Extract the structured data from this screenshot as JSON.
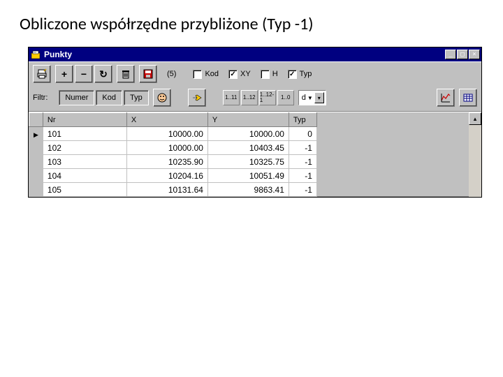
{
  "heading": "Obliczone współrzędne przybliżone (Typ -1)",
  "window": {
    "title": "Punkty",
    "count_text": "(5)",
    "checkboxes": {
      "kod": {
        "label": "Kod",
        "checked": false
      },
      "xy": {
        "label": "XY",
        "checked": true
      },
      "h": {
        "label": "H",
        "checked": false
      },
      "typ": {
        "label": "Typ",
        "checked": true
      }
    },
    "filter_label": "Filtr:",
    "filter_buttons": {
      "numer": "Numer",
      "kod": "Kod",
      "typ": "Typ"
    },
    "decimal_btns": [
      "1..11",
      "1..12",
      "1..12-1",
      "1..0"
    ],
    "combo_d": "d",
    "columns": {
      "nr": "Nr",
      "x": "X",
      "y": "Y",
      "typ": "Typ"
    },
    "rows": [
      {
        "cursor": true,
        "nr": "101",
        "x": "10000.00",
        "y": "10000.00",
        "typ": "0"
      },
      {
        "cursor": false,
        "nr": "102",
        "x": "10000.00",
        "y": "10403.45",
        "typ": "-1"
      },
      {
        "cursor": false,
        "nr": "103",
        "x": "10235.90",
        "y": "10325.75",
        "typ": "-1"
      },
      {
        "cursor": false,
        "nr": "104",
        "x": "10204.16",
        "y": "10051.49",
        "typ": "-1"
      },
      {
        "cursor": false,
        "nr": "105",
        "x": "10131.64",
        "y": "9863.41",
        "typ": "-1"
      }
    ]
  }
}
